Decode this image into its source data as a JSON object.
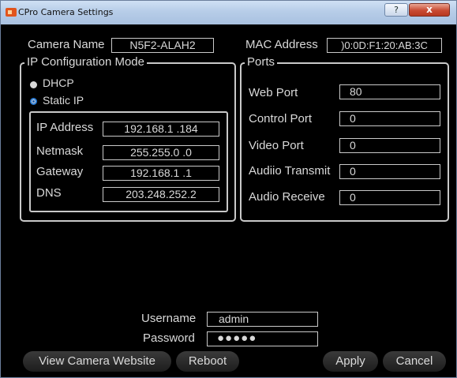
{
  "window": {
    "title": "CPro Camera Settings",
    "help_label": "?",
    "close_label": "x"
  },
  "camera": {
    "name_label": "Camera Name",
    "name_value": "N5F2-ALAH2",
    "mac_label": "MAC Address",
    "mac_value": ")0:0D:F1:20:AB:3C"
  },
  "ip_config": {
    "title": "IP Configuration Mode",
    "dhcp_label": "DHCP",
    "static_label": "Static IP",
    "selected": "Static IP",
    "ip_label": "IP Address",
    "ip_value": "192.168.1  .184",
    "netmask_label": "Netmask",
    "netmask_value": "255.255.0  .0",
    "gateway_label": "Gateway",
    "gateway_value": "192.168.1  .1",
    "dns_label": "DNS",
    "dns_value": "203.248.252.2"
  },
  "ports": {
    "title": "Ports",
    "web_label": "Web Port",
    "web_value": "80",
    "control_label": "Control Port",
    "control_value": "0",
    "video_label": "Video Port",
    "video_value": "0",
    "audio_tx_label": "Audiio Transmit",
    "audio_tx_value": "0",
    "audio_rx_label": "Audio Receive",
    "audio_rx_value": "0"
  },
  "login": {
    "username_label": "Username",
    "username_value": "admin",
    "password_label": "Password",
    "password_mask": "●●●●●"
  },
  "buttons": {
    "view_website": "View Camera Website",
    "reboot": "Reboot",
    "apply": "Apply",
    "cancel": "Cancel"
  },
  "colors": {
    "titlebar": "#b7cde8",
    "close": "#c84a32",
    "radio_selected": "#2b7dd6",
    "field_border": "#c9c9c9"
  }
}
